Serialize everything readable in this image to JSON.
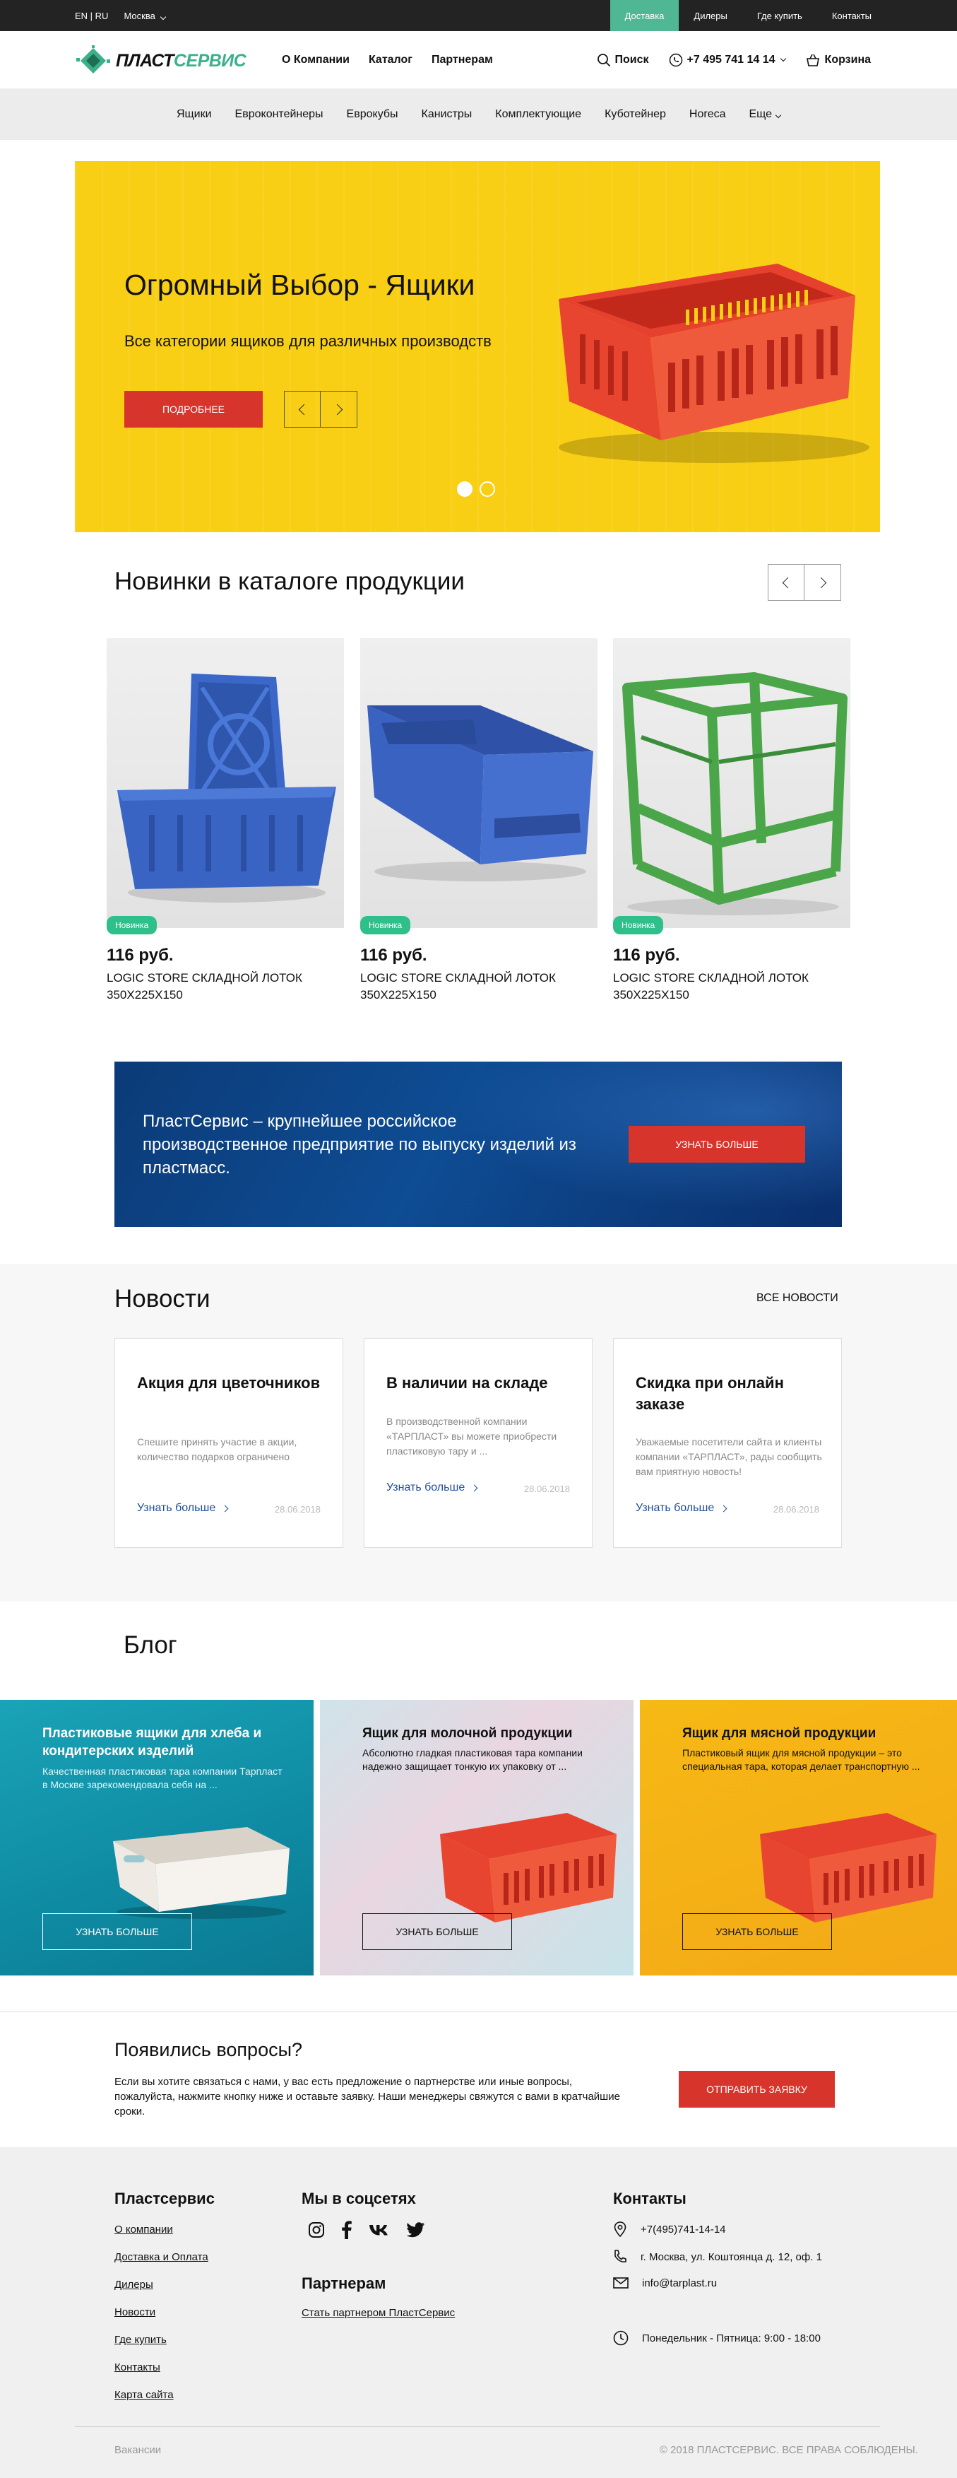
{
  "topbar": {
    "lang": "EN | RU",
    "city": "Москва",
    "links": [
      "Доставка",
      "Дилеры",
      "Где купить",
      "Контакты"
    ],
    "active_color": "#4fb793"
  },
  "header": {
    "logo_part1": "ПЛАСТ",
    "logo_part2": "СЕРВИС",
    "nav": [
      "О Компании",
      "Каталог",
      "Партнерам"
    ],
    "search": "Поиск",
    "phone": "+7 495 741 14 14",
    "cart": "Корзина"
  },
  "categories": [
    "Ящики",
    "Евроконтейнеры",
    "Еврокубы",
    "Канистры",
    "Комплектующие",
    "Куботейнер",
    "Horeca",
    "Еще"
  ],
  "hero": {
    "title": "Огромный Выбор - Ящики",
    "subtitle": "Все категории ящиков для различных производств",
    "button": "Подробнее",
    "slides_total": 2,
    "slide_active": 1,
    "bg_color": "#f8cf14"
  },
  "new_products": {
    "title": "Новинки в каталоге продукции",
    "items": [
      {
        "badge": "Новинка",
        "price": "116 руб.",
        "name": "LOGIC STORE СКЛАДНОЙ ЛОТОК 350Х225Х150",
        "icon": "blue-tray-icon"
      },
      {
        "badge": "Новинка",
        "price": "116 руб.",
        "name": "LOGIC STORE СКЛАДНОЙ ЛОТОК 350Х225Х150",
        "icon": "blue-bin-icon"
      },
      {
        "badge": "Новинка",
        "price": "116 руб.",
        "name": "LOGIC STORE СКЛАДНОЙ ЛОТОК 350Х225Х150",
        "icon": "green-frame-icon"
      }
    ]
  },
  "promo": {
    "text": "ПластСервис – крупнейшее российское производственное предприятие по выпуску изделий из пластмасс.",
    "button": "Узнать больше"
  },
  "news": {
    "title": "Новости",
    "all": "ВСЕ НОВОСТИ",
    "items": [
      {
        "title": "Акция для цветочников",
        "text": "Спешите принять участие в акции, количество подарков ограничено",
        "more": "Узнать больше",
        "date": "28.06.2018"
      },
      {
        "title": "В наличии на складе",
        "text": "В производственной компании «ТАРПЛАСТ» вы можете приобрести пластиковую тару и ...",
        "more": "Узнать больше",
        "date": "28.06.2018"
      },
      {
        "title": "Скидка при онлайн заказе",
        "text": "Уважаемые посетители сайта и клиенты компании «ТАРПЛАСТ», рады сообщить вам приятную новость!",
        "more": "Узнать больше",
        "date": "28.06.2018"
      }
    ]
  },
  "blog": {
    "title": "Блог",
    "items": [
      {
        "title": "Пластиковые ящики для хлеба и кондитерских изделий",
        "text": "Качественная пластиковая тара компании Тарпласт в Москве зарекомендовала себя на ...",
        "button": "Узнать больше"
      },
      {
        "title": "Ящик для молочной продукции",
        "text": "Абсолютно гладкая пластиковая тара компании надежно защищает тонкую их упаковку от ...",
        "button": "Узнать больше"
      },
      {
        "title": "Ящик для мясной продукции",
        "text": "Пластиковый ящик для мясной продукции – это специальная тара, которая делает транспортную ...",
        "button": "Узнать больше"
      }
    ]
  },
  "questions": {
    "title": "Появились вопросы?",
    "text": "Если вы хотите связаться с нами, у вас есть предложение о партнерстве или иные вопросы, пожалуйста, нажмите кнопку ниже и оставьте заявку. Наши менеджеры свяжутся с вами в кратчайшие сроки.",
    "button": "Отправить заявку"
  },
  "footer": {
    "company_title": "Пластсервис",
    "company_links": [
      "О компании",
      "Доставка и Оплата",
      "Дилеры",
      "Новости",
      "Где купить",
      "Контакты",
      "Карта сайта"
    ],
    "social_title": "Мы в соцсетях",
    "social_icons": [
      "instagram-icon",
      "facebook-icon",
      "vk-icon",
      "twitter-icon"
    ],
    "partners_title": "Партнерам",
    "partners_link": "Стать партнером ПластСервис",
    "contacts_title": "Контакты",
    "phone": "+7(495)741-14-14",
    "address": "г. Москва, ул. Коштоянца д. 12, оф. 1",
    "email": "info@tarplast.ru",
    "hours": "Понедельник - Пятница: 9:00 - 18:00",
    "vacancies": "Вакансии",
    "copyright": "© 2018 ПЛАСТСЕРВИС. ВСЕ ПРАВА СОБЛЮДЕНЫ."
  }
}
